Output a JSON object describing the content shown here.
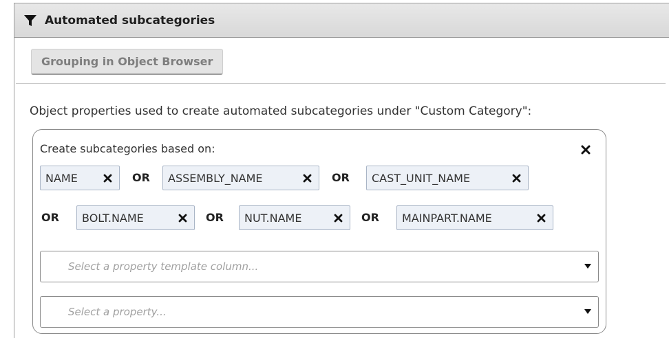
{
  "panel": {
    "title": "Automated subcategories",
    "grouping_button_label": "Grouping in Object Browser"
  },
  "description": "Object properties used to create automated subcategories under \"Custom Category\":",
  "subcategories": {
    "label": "Create subcategories based on:",
    "connector": "OR",
    "chips": [
      "NAME",
      "ASSEMBLY_NAME",
      "CAST_UNIT_NAME",
      "BOLT.NAME",
      "NUT.NAME",
      "MAINPART.NAME"
    ]
  },
  "selects": {
    "template_column_placeholder": "Select a property template column...",
    "property_placeholder": "Select a property..."
  },
  "icons": {
    "header": "filter-icon",
    "remove": "close-icon",
    "dropdown": "caret-down-icon"
  }
}
